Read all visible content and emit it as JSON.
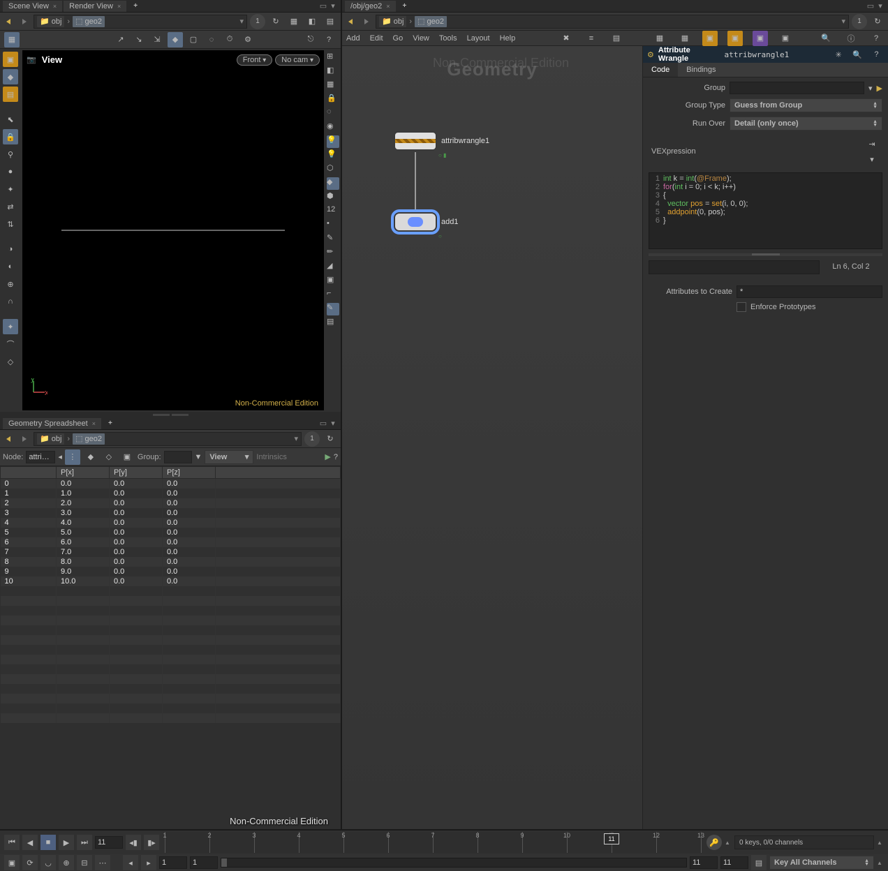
{
  "left_tabs": [
    "Scene View",
    "Render View"
  ],
  "right_tabs": [
    "/obj/geo2"
  ],
  "path": {
    "root": "obj",
    "leaf": "geo2"
  },
  "pin": "1",
  "viewport": {
    "title": "View",
    "camera": "Front",
    "cam2": "No cam",
    "edition": "Non-Commercial Edition"
  },
  "spread_tab": "Geometry Spreadsheet",
  "spread": {
    "node_label": "Node:",
    "node": "attri…",
    "group_label": "Group:",
    "view": "View",
    "intr": "Intrinsics",
    "cols": [
      "",
      "P[x]",
      "P[y]",
      "P[z]"
    ],
    "rows": [
      [
        "0",
        "0.0",
        "0.0",
        "0.0"
      ],
      [
        "1",
        "1.0",
        "0.0",
        "0.0"
      ],
      [
        "2",
        "2.0",
        "0.0",
        "0.0"
      ],
      [
        "3",
        "3.0",
        "0.0",
        "0.0"
      ],
      [
        "4",
        "4.0",
        "0.0",
        "0.0"
      ],
      [
        "5",
        "5.0",
        "0.0",
        "0.0"
      ],
      [
        "6",
        "6.0",
        "0.0",
        "0.0"
      ],
      [
        "7",
        "7.0",
        "0.0",
        "0.0"
      ],
      [
        "8",
        "8.0",
        "0.0",
        "0.0"
      ],
      [
        "9",
        "9.0",
        "0.0",
        "0.0"
      ],
      [
        "10",
        "10.0",
        "0.0",
        "0.0"
      ]
    ]
  },
  "menu": [
    "Add",
    "Edit",
    "Go",
    "View",
    "Tools",
    "Layout",
    "Help"
  ],
  "watermark2": "Geometry",
  "watermark1": "Non-Commercial Edition",
  "nodes": {
    "n1": "attribwrangle1",
    "n2": "add1"
  },
  "params": {
    "title": "Attribute Wrangle",
    "node": "attribwrangle1",
    "tabs": [
      "Code",
      "Bindings"
    ],
    "group_label": "Group",
    "group": "",
    "grouptype_label": "Group Type",
    "grouptype": "Guess from Group",
    "runover_label": "Run Over",
    "runover": "Detail (only once)",
    "vex_label": "VEXpression",
    "status": "Ln 6, Col 2",
    "attrs_label": "Attributes to Create",
    "attrs": "*",
    "enforce": "Enforce Prototypes"
  },
  "code": [
    {
      "n": 1,
      "tokens": [
        [
          "ty",
          "int"
        ],
        [
          "pu",
          " k = "
        ],
        [
          "ty",
          "int"
        ],
        [
          "pu",
          "("
        ],
        [
          "at",
          "@Frame"
        ],
        [
          "pu",
          ");"
        ]
      ]
    },
    {
      "n": 2,
      "tokens": [
        [
          "kw",
          "for"
        ],
        [
          "pu",
          "("
        ],
        [
          "ty",
          "int"
        ],
        [
          "pu",
          " i = 0; i < k; i++)"
        ]
      ]
    },
    {
      "n": 3,
      "tokens": [
        [
          "pu",
          "{"
        ]
      ]
    },
    {
      "n": 4,
      "tokens": [
        [
          "pu",
          "  "
        ],
        [
          "ty",
          "vector"
        ],
        [
          "pu",
          " "
        ],
        [
          "fn",
          "pos"
        ],
        [
          "pu",
          " = "
        ],
        [
          "fn",
          "set"
        ],
        [
          "pu",
          "(i, 0, 0);"
        ]
      ]
    },
    {
      "n": 5,
      "tokens": [
        [
          "pu",
          "  "
        ],
        [
          "fn",
          "addpoint"
        ],
        [
          "pu",
          "(0, pos);"
        ]
      ]
    },
    {
      "n": 6,
      "tokens": [
        [
          "pu",
          "}"
        ]
      ]
    }
  ],
  "timeline": {
    "frame": "11",
    "start": "1",
    "end": "11",
    "ticks": [
      1,
      2,
      3,
      4,
      5,
      6,
      7,
      8,
      9,
      10,
      11,
      12,
      13
    ],
    "keys": "0 keys, 0/0 channels",
    "keymode": "Key All Channels",
    "r1": "1",
    "r2": "1",
    "r3": "11",
    "r4": "11"
  }
}
